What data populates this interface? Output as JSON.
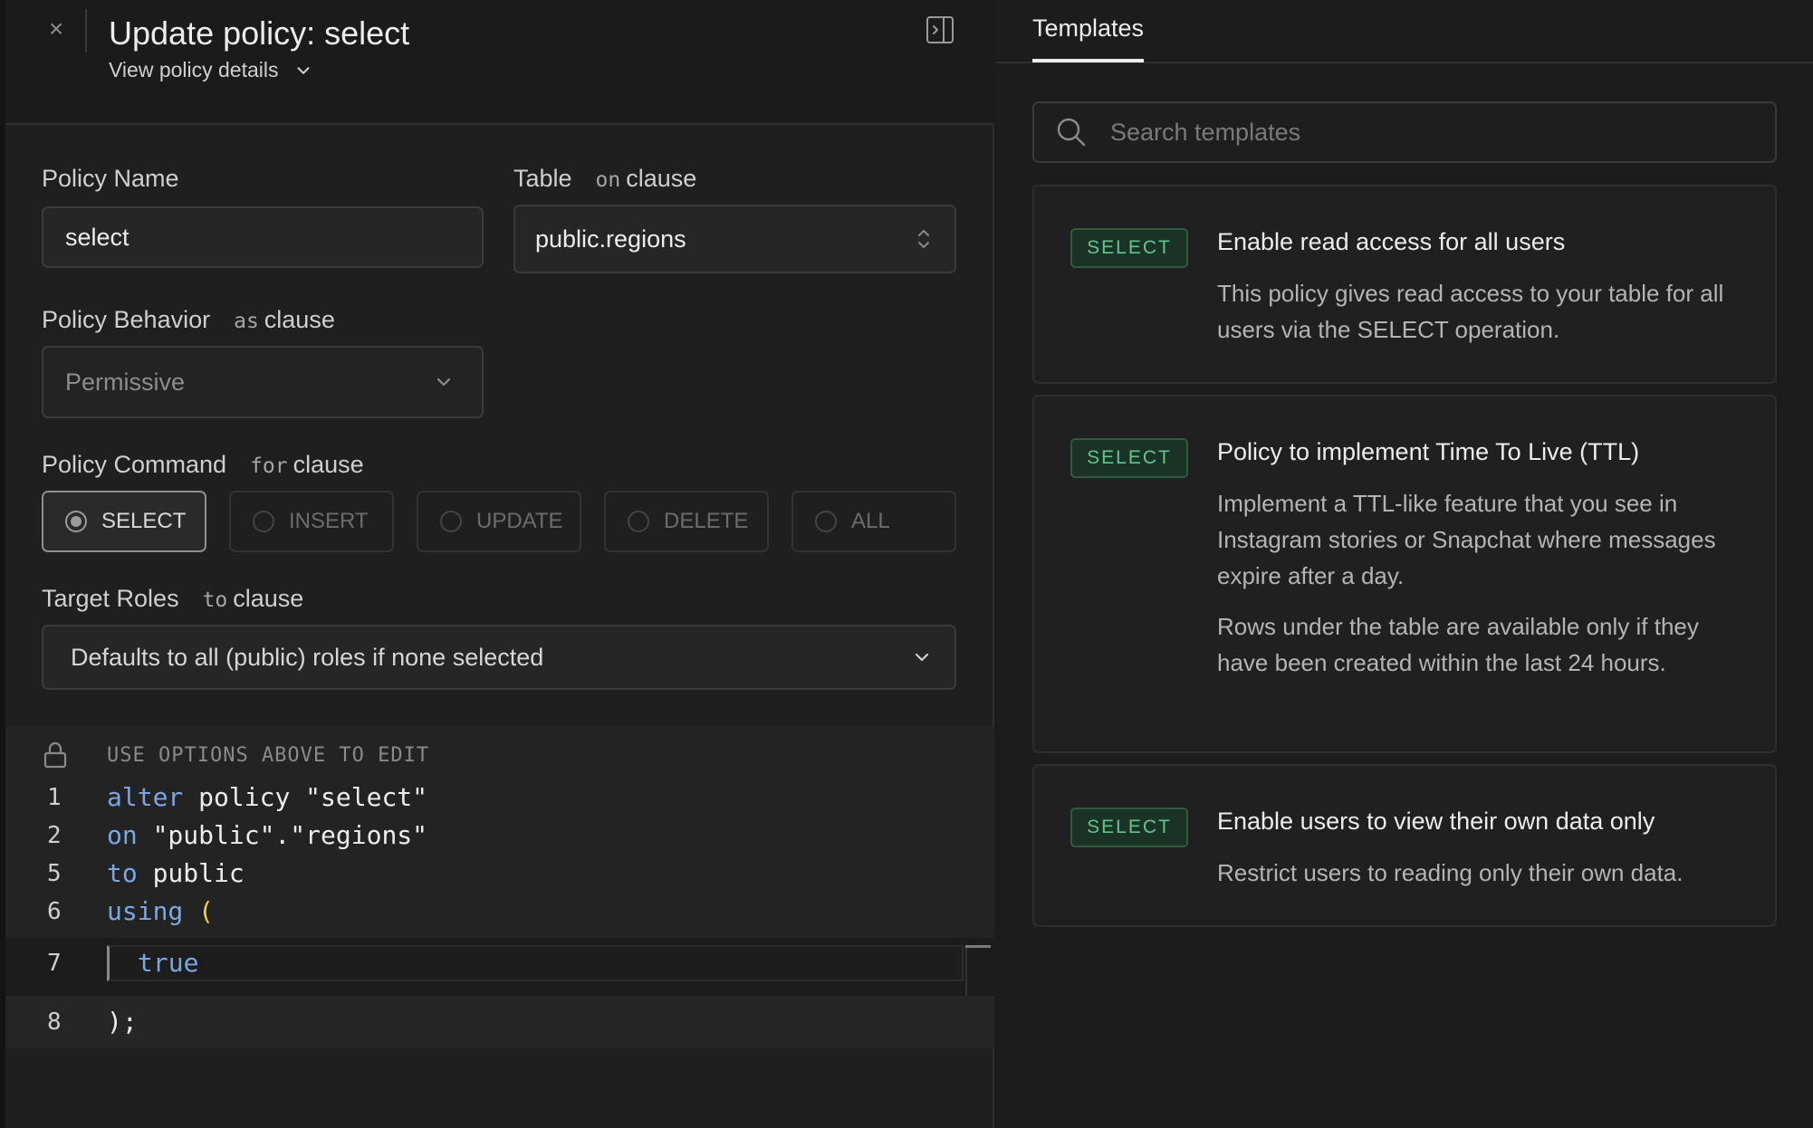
{
  "header": {
    "title": "Update policy: select",
    "view_details": "View policy details"
  },
  "form": {
    "policy_name": {
      "label": "Policy Name",
      "value": "select"
    },
    "table": {
      "label": "Table",
      "keyword": "on",
      "clause": "clause",
      "value": "public.regions"
    },
    "behavior": {
      "label": "Policy Behavior",
      "keyword": "as",
      "clause": "clause",
      "value": "Permissive"
    },
    "command": {
      "label": "Policy Command",
      "keyword": "for",
      "clause": "clause",
      "options": [
        "SELECT",
        "INSERT",
        "UPDATE",
        "DELETE",
        "ALL"
      ],
      "selected": "SELECT"
    },
    "roles": {
      "label": "Target Roles",
      "keyword": "to",
      "clause": "clause",
      "placeholder": "Defaults to all (public) roles if none selected"
    }
  },
  "editor": {
    "hint": "USE OPTIONS ABOVE TO EDIT",
    "lines": [
      {
        "num": "1",
        "kw": "alter",
        "rest": " policy \"select\""
      },
      {
        "num": "2",
        "kw": "on",
        "rest": " \"public\".\"regions\""
      },
      {
        "num": "5",
        "kw": "to",
        "rest": " public"
      },
      {
        "num": "6",
        "kw": "using",
        "rest": "("
      },
      {
        "num": "7",
        "kw": "true",
        "rest": ""
      },
      {
        "num": "8",
        "kw": "",
        "rest": ");"
      }
    ]
  },
  "templates": {
    "tab_label": "Templates",
    "search_placeholder": "Search templates",
    "cards": [
      {
        "badge": "SELECT",
        "title": "Enable read access for all users",
        "desc": "This policy gives read access to your table for all users via the SELECT operation."
      },
      {
        "badge": "SELECT",
        "title": "Policy to implement Time To Live (TTL)",
        "desc": "Implement a TTL-like feature that you see in Instagram stories or Snapchat where messages expire after a day.",
        "desc2": "Rows under the table are available only if they have been created within the last 24 hours."
      },
      {
        "badge": "SELECT",
        "title": "Enable users to view their own data only",
        "desc": "Restrict users to reading only their own data."
      }
    ]
  }
}
